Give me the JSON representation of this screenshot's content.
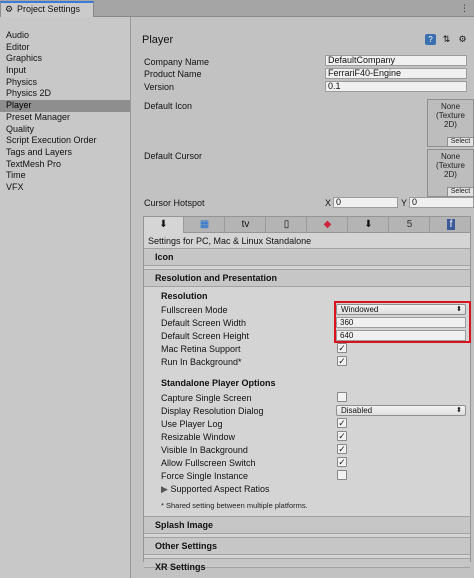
{
  "window": {
    "tab_title": "Project Settings",
    "icon": "gear-icon",
    "menu_icon": "kebab-menu-icon"
  },
  "sidebar": {
    "items": [
      {
        "label": "Audio"
      },
      {
        "label": "Editor"
      },
      {
        "label": "Graphics"
      },
      {
        "label": "Input"
      },
      {
        "label": "Physics"
      },
      {
        "label": "Physics 2D"
      },
      {
        "label": "Player",
        "selected": true
      },
      {
        "label": "Preset Manager"
      },
      {
        "label": "Quality"
      },
      {
        "label": "Script Execution Order"
      },
      {
        "label": "Tags and Layers"
      },
      {
        "label": "TextMesh Pro"
      },
      {
        "label": "Time"
      },
      {
        "label": "VFX"
      }
    ]
  },
  "main": {
    "title": "Player",
    "company_label": "Company Name",
    "company_value": "DefaultCompany",
    "product_label": "Product Name",
    "product_value": "FerrariF40-Engine",
    "version_label": "Version",
    "version_value": "0.1",
    "default_icon_label": "Default Icon",
    "default_cursor_label": "Default Cursor",
    "texture_text": "None\n(Texture\n2D)",
    "select_label": "Select",
    "cursor_hotspot_label": "Cursor Hotspot",
    "x_label": "X",
    "x_value": "0",
    "y_label": "Y",
    "y_value": "0"
  },
  "platform_tabs": [
    {
      "name": "standalone",
      "icon": "download-arrow-icon",
      "active": true
    },
    {
      "name": "windows-store",
      "icon": "windows-icon"
    },
    {
      "name": "apple-tv",
      "icon": "apple-tv-icon"
    },
    {
      "name": "ios",
      "icon": "phone-icon"
    },
    {
      "name": "lumin",
      "icon": "lumin-icon"
    },
    {
      "name": "android",
      "icon": "download-arrow-icon"
    },
    {
      "name": "webgl",
      "icon": "html5-icon"
    },
    {
      "name": "facebook",
      "icon": "facebook-icon"
    }
  ],
  "settings": {
    "settings_for": "Settings for PC, Mac & Linux Standalone",
    "icon_section": "Icon",
    "resolution_section": "Resolution and Presentation",
    "resolution_sub": "Resolution",
    "fullscreen_mode_label": "Fullscreen Mode",
    "fullscreen_mode_value": "Windowed",
    "width_label": "Default Screen Width",
    "width_value": "360",
    "height_label": "Default Screen Height",
    "height_value": "640",
    "mac_retina_label": "Mac Retina Support",
    "mac_retina_checked": true,
    "run_bg_label": "Run In Background*",
    "run_bg_checked": true,
    "standalone_sub": "Standalone Player Options",
    "capture_label": "Capture Single Screen",
    "capture_checked": false,
    "display_dialog_label": "Display Resolution Dialog",
    "display_dialog_value": "Disabled",
    "use_log_label": "Use Player Log",
    "use_log_checked": true,
    "resizable_label": "Resizable Window",
    "resizable_checked": true,
    "visible_bg_label": "Visible In Background",
    "visible_bg_checked": true,
    "allow_fs_switch_label": "Allow Fullscreen Switch",
    "allow_fs_switch_checked": true,
    "force_single_label": "Force Single Instance",
    "force_single_checked": false,
    "aspect_label": "Supported Aspect Ratios",
    "shared_note": "* Shared setting between multiple platforms.",
    "splash_section": "Splash Image",
    "other_section": "Other Settings",
    "xr_section": "XR Settings"
  },
  "colors": {
    "highlight": "#d9121b",
    "accent": "#3b7bd6"
  }
}
